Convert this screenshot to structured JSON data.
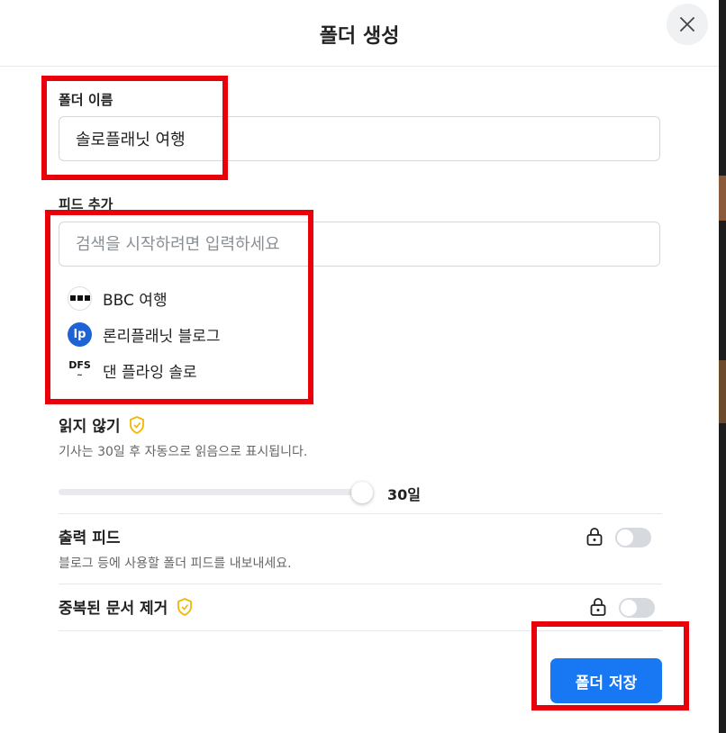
{
  "modal": {
    "title": "폴더 생성"
  },
  "folder_name": {
    "label": "폴더 이름",
    "value": "솔로플래닛 여행"
  },
  "add_feed": {
    "label": "피드 추가",
    "placeholder": "검색을 시작하려면 입력하세요",
    "items": [
      {
        "name": "BBC 여행",
        "icon": "bbc-icon"
      },
      {
        "name": "론리플래닛 블로그",
        "icon": "lp-icon"
      },
      {
        "name": "댄 플라잉 솔로",
        "icon": "dfs-icon"
      }
    ]
  },
  "unread": {
    "title": "읽지 않기",
    "description": "기사는 30일 후 자동으로 읽음으로 표시됩니다.",
    "slider_value": "30일"
  },
  "output_feed": {
    "title": "출력 피드",
    "description": "블로그 등에 사용할 폴더 피드를 내보내세요."
  },
  "dedupe": {
    "title": "중복된 문서 제거"
  },
  "save_label": "폴더 저장",
  "colors": {
    "accent": "#1877f2",
    "highlight": "#e8000b",
    "shield": "#f2b705"
  }
}
